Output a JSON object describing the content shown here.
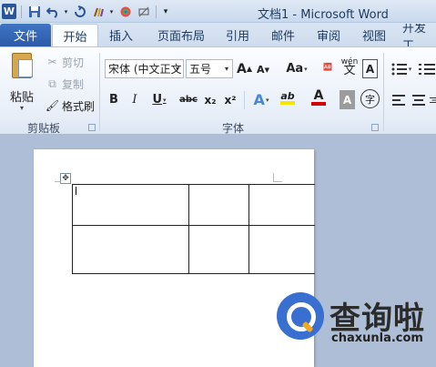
{
  "titlebar": {
    "app_logo": "W",
    "title": "文档1 - Microsoft Word",
    "qat_icons": [
      "save-icon",
      "undo-icon",
      "redo-icon",
      "format-painter-icon",
      "color-icon",
      "clear-icon",
      "customize-icon"
    ]
  },
  "tabs": [
    {
      "label": "文件"
    },
    {
      "label": "开始"
    },
    {
      "label": "插入"
    },
    {
      "label": "页面布局"
    },
    {
      "label": "引用"
    },
    {
      "label": "邮件"
    },
    {
      "label": "审阅"
    },
    {
      "label": "视图"
    },
    {
      "label": "开发工"
    }
  ],
  "clipboard": {
    "paste": "粘贴",
    "cut": "剪切",
    "copy": "复制",
    "format_painter": "格式刷",
    "group_label": "剪贴板"
  },
  "font": {
    "font_name": "宋体 (中文正文",
    "font_size": "五号",
    "grow": "A",
    "shrink": "A",
    "change_case": "Aa",
    "phonetic": "wén",
    "bold": "B",
    "italic": "I",
    "underline": "U",
    "strike": "abc",
    "subscript": "x₂",
    "superscript": "x²",
    "text_effect": "A",
    "highlight": "ab",
    "font_color": "A",
    "char_shading": "A",
    "enclose": "字",
    "group_label": "字体",
    "colors": {
      "highlight": "#f5e600",
      "font_color": "#d40000"
    }
  },
  "colors": {
    "file_tab": "#2b5aa8",
    "watermark_blue": "#3a6fd2"
  },
  "watermark": {
    "title": "查询啦",
    "url": "chaxunla.com"
  }
}
